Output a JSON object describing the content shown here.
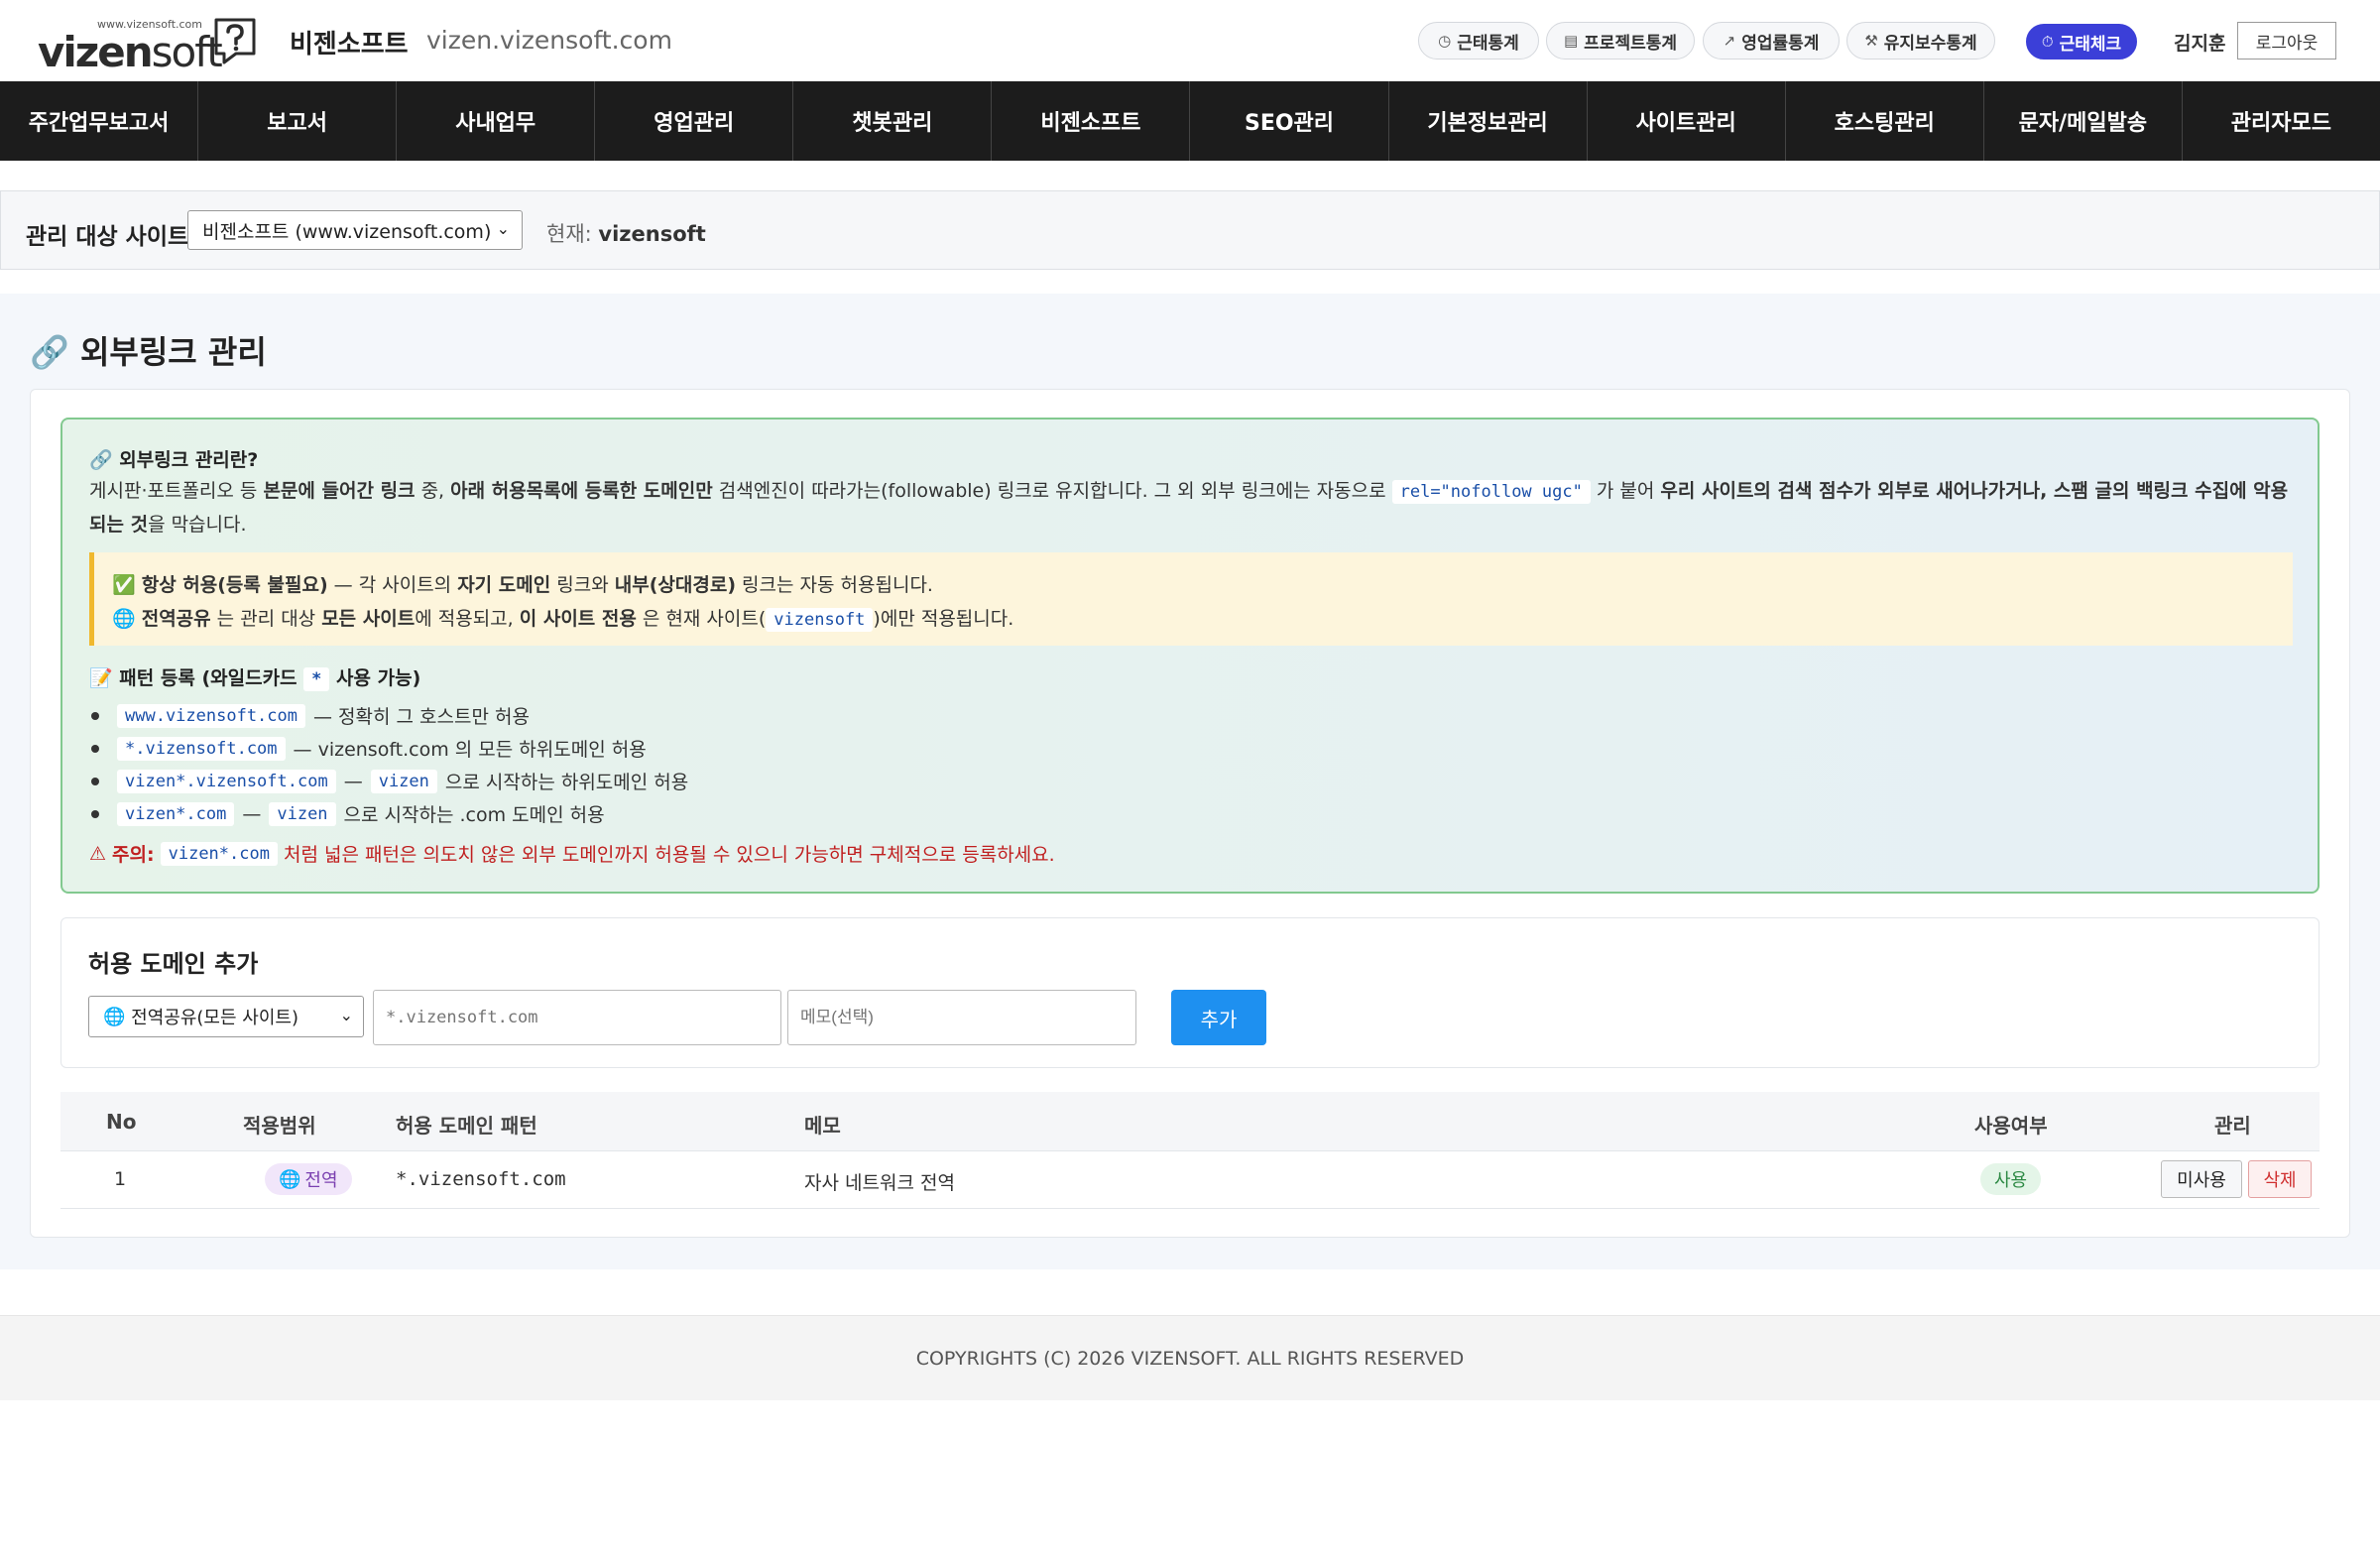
{
  "header": {
    "logo_small": "www.vizensoft.com",
    "logo_text_bold": "vizen",
    "logo_text_thin": "soft",
    "site_name": "비젠소프트",
    "site_domain": "vizen.vizensoft.com",
    "quick_links": [
      {
        "label": "근태통계",
        "icon": "clock-icon"
      },
      {
        "label": "프로젝트통계",
        "icon": "clipboard-icon"
      },
      {
        "label": "영업률통계",
        "icon": "trend-up-icon"
      },
      {
        "label": "유지보수통계",
        "icon": "wrench-icon"
      }
    ],
    "attendance_label": "근태체크",
    "user_name": "김지훈",
    "logout_label": "로그아웃"
  },
  "nav": {
    "items": [
      "주간업무보고서",
      "보고서",
      "사내업무",
      "영업관리",
      "챗봇관리",
      "비젠소프트",
      "SEO관리",
      "기본정보관리",
      "사이트관리",
      "호스팅관리",
      "문자/메일발송",
      "관리자모드"
    ]
  },
  "site_bar": {
    "label": "관리 대상 사이트",
    "selected": "비젠소프트 (www.vizensoft.com)",
    "current_label": "현재:",
    "current_value": "vizensoft"
  },
  "page": {
    "title": "외부링크 관리"
  },
  "info": {
    "title": "외부링크 관리란?",
    "desc_1": "게시판·포트폴리오 등 ",
    "desc_b1": "본문에 들어간 링크",
    "desc_2": " 중, ",
    "desc_b2": "아래 허용목록에 등록한 도메인만",
    "desc_3": " 검색엔진이 따라가는(followable) 링크로 유지합니다. 그 외 외부 링크에는 자동으로 ",
    "desc_code": "rel=\"nofollow ugc\"",
    "desc_4": " 가 붙어 ",
    "desc_b3": "우리 사이트의 검색 점수가 외부로 새어나가거나, 스팸 글의 백링크 수집에 악용되는 것",
    "desc_5": "을 막습니다.",
    "notice_1_icon": "✅",
    "notice_1_b1": "항상 허용(등록 불필요)",
    "notice_1_t1": " — 각 사이트의 ",
    "notice_1_b2": "자기 도메인",
    "notice_1_t2": " 링크와 ",
    "notice_1_b3": "내부(상대경로)",
    "notice_1_t3": " 링크는 자동 허용됩니다.",
    "notice_2_icon": "🌐",
    "notice_2_b1": "전역공유",
    "notice_2_t1": " 는 관리 대상 ",
    "notice_2_b2": "모든 사이트",
    "notice_2_t2": "에 적용되고, ",
    "notice_2_b3": "이 사이트 전용",
    "notice_2_t3": " 은 현재 사이트(",
    "notice_2_code": "vizensoft",
    "notice_2_t4": ")에만 적용됩니다.",
    "pattern_title_1": "패턴 등록 (와일드카드",
    "pattern_code": "*",
    "pattern_title_2": "사용 가능)",
    "patterns": [
      {
        "code": "www.vizensoft.com",
        "text": "— 정확히 그 호스트만 허용"
      },
      {
        "code": "*.vizensoft.com",
        "text": "— vizensoft.com 의 모든 하위도메인 허용"
      },
      {
        "code": "vizen*.vizensoft.com",
        "text": "—",
        "code2": "vizen",
        "text2": "으로 시작하는 하위도메인 허용"
      },
      {
        "code": "vizen*.com",
        "text": "—",
        "code2": "vizen",
        "text2": "으로 시작하는 .com 도메인 허용"
      }
    ],
    "warn_label": "주의:",
    "warn_code": "vizen*.com",
    "warn_text": "처럼 넓은 패턴은 의도치 않은 외부 도메인까지 허용될 수 있으니 가능하면 구체적으로 등록하세요."
  },
  "form": {
    "title": "허용 도메인 추가",
    "scope_selected": "전역공유(모든 사이트)",
    "domain_placeholder": "*.vizensoft.com",
    "memo_placeholder": "메모(선택)",
    "add_label": "추가"
  },
  "table": {
    "headers": {
      "no": "No",
      "scope": "적용범위",
      "pattern": "허용 도메인 패턴",
      "memo": "메모",
      "status": "사용여부",
      "manage": "관리"
    },
    "rows": [
      {
        "no": "1",
        "scope": "전역",
        "pattern": "*.vizensoft.com",
        "memo": "자사 네트워크 전역",
        "status": "사용",
        "toggle_label": "미사용",
        "delete_label": "삭제"
      }
    ]
  },
  "footer": {
    "copyright": "COPYRIGHTS (C) 2026 VIZENSOFT. ALL RIGHTS RESERVED"
  },
  "colors": {
    "nav_bg": "#1c1c1c",
    "primary": "#3b3fd8",
    "add_button": "#1e90f0",
    "warn": "#c02020",
    "info_border": "#82c98f",
    "notice_border": "#f0b82e"
  }
}
